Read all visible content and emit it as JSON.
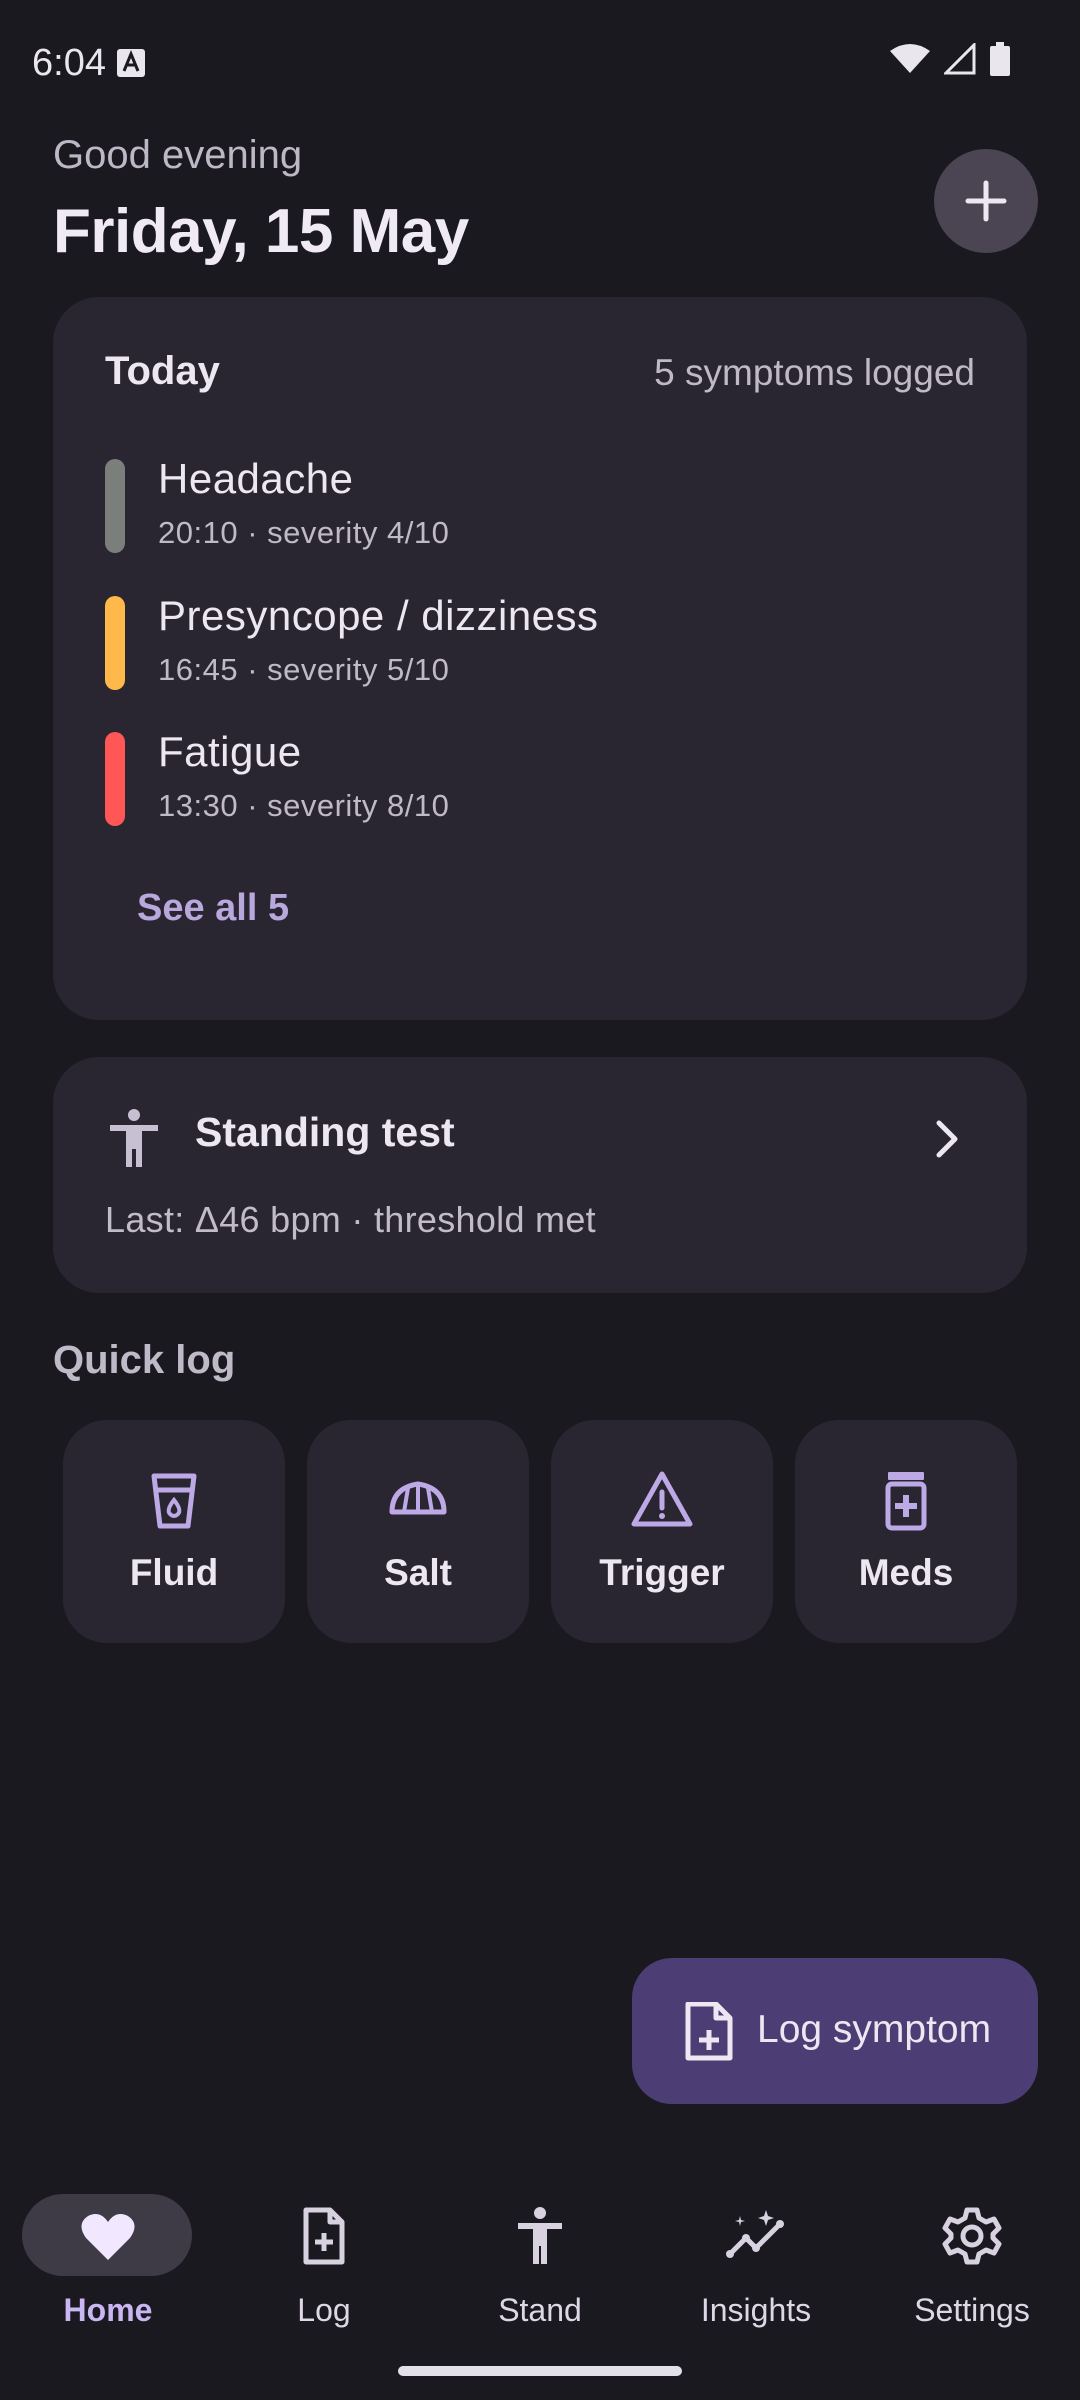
{
  "status_bar": {
    "time": "6:04"
  },
  "header": {
    "greeting": "Good evening",
    "date": "Friday, 15 May"
  },
  "today": {
    "title": "Today",
    "count_text": "5 symptoms logged",
    "symptoms": [
      {
        "name": "Headache",
        "meta": "20:10 · severity 4/10",
        "color": "#7b7f7b"
      },
      {
        "name": "Presyncope / dizziness",
        "meta": "16:45 · severity 5/10",
        "color": "#ffb84a"
      },
      {
        "name": "Fatigue",
        "meta": "13:30 · severity 8/10",
        "color": "#ff5656"
      }
    ],
    "see_all": "See all 5"
  },
  "standing_test": {
    "title": "Standing test",
    "subtitle": "Last: Δ46 bpm · threshold met"
  },
  "quick_log": {
    "title": "Quick log",
    "items": [
      {
        "label": "Fluid",
        "icon": "cup-icon"
      },
      {
        "label": "Salt",
        "icon": "salt-shaker-icon"
      },
      {
        "label": "Trigger",
        "icon": "warning-icon"
      },
      {
        "label": "Meds",
        "icon": "medication-icon"
      }
    ]
  },
  "fab": {
    "label": "Log symptom",
    "icon": "note-add-icon"
  },
  "nav": {
    "items": [
      {
        "label": "Home",
        "icon": "heart-icon",
        "active": true
      },
      {
        "label": "Log",
        "icon": "note-add-icon"
      },
      {
        "label": "Stand",
        "icon": "person-standing-icon"
      },
      {
        "label": "Insights",
        "icon": "insights-icon"
      },
      {
        "label": "Settings",
        "icon": "gear-icon"
      }
    ]
  },
  "colors": {
    "background": "#1b1920",
    "card": "#2a2631",
    "accent": "#c9b6f2",
    "fab": "#4c3e75"
  }
}
